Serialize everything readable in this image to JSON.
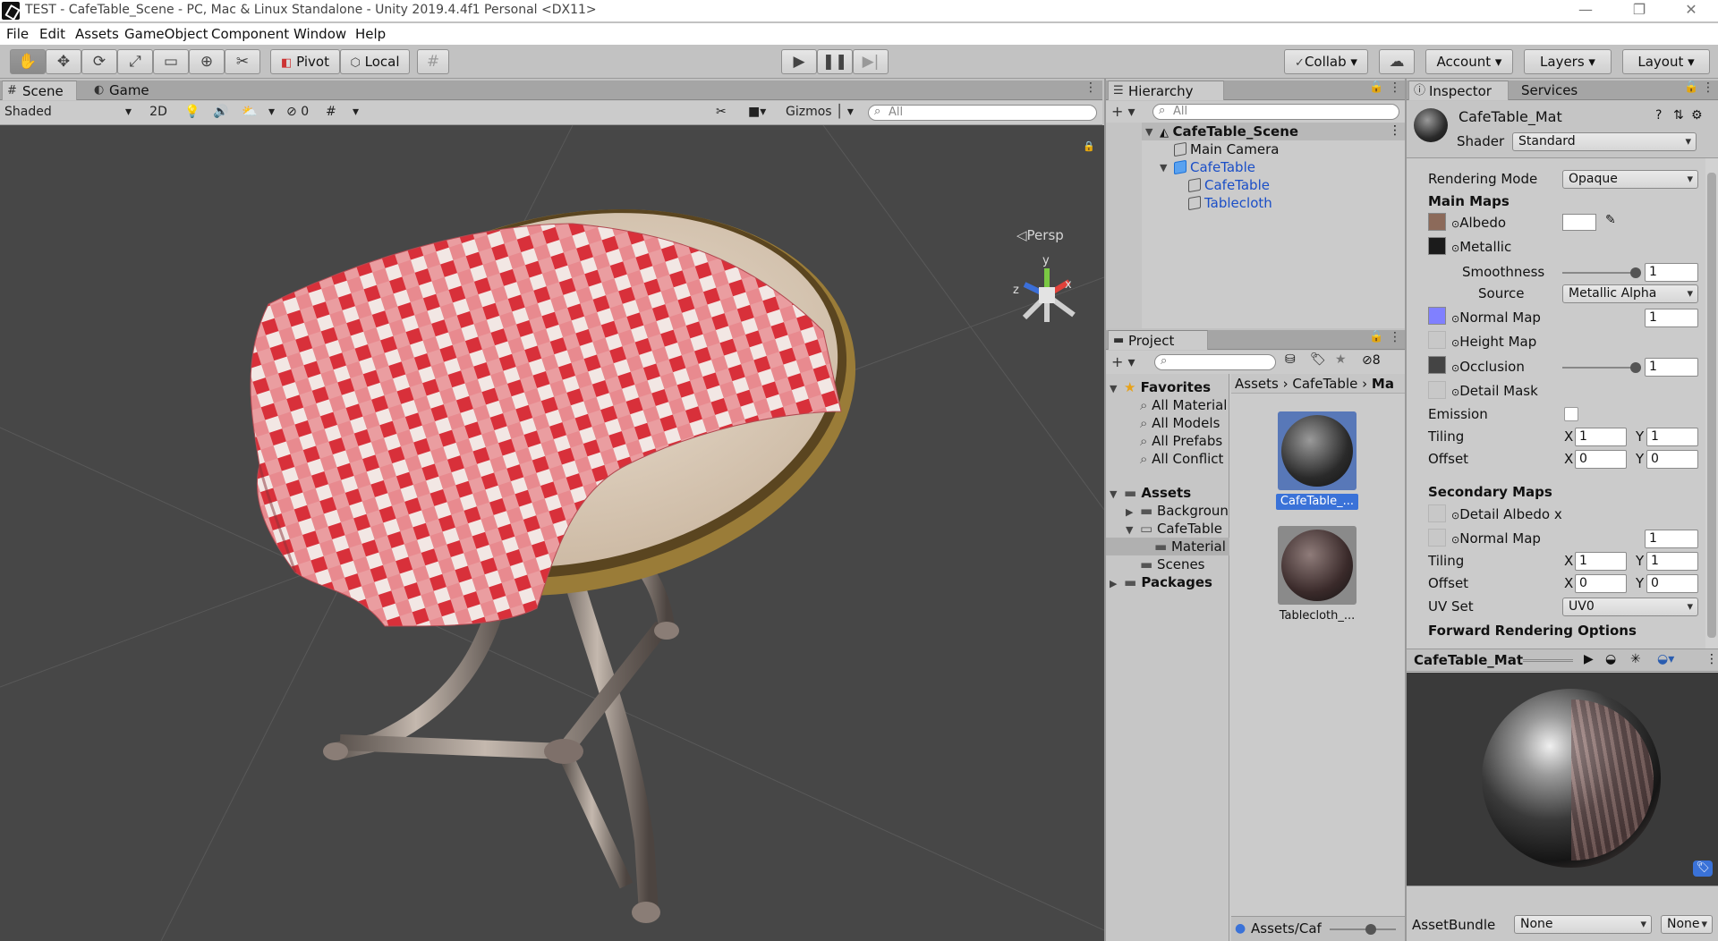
{
  "window": {
    "title": "TEST - CafeTable_Scene - PC, Mac & Linux Standalone - Unity 2019.4.4f1 Personal <DX11>",
    "minimize": "—",
    "maximize": "❐",
    "close": "✕"
  },
  "menu": [
    "File",
    "Edit",
    "Assets",
    "GameObject",
    "Component",
    "Window",
    "Help"
  ],
  "toolbar": {
    "pivot": "Pivot",
    "local": "Local",
    "collab": "Collab",
    "account": "Account",
    "layers": "Layers",
    "layout": "Layout"
  },
  "scene": {
    "tabs": [
      "Scene",
      "Game"
    ],
    "shading": "Shaded",
    "mode_2d": "2D",
    "hidden_count": "0",
    "gizmos": "Gizmos",
    "search_placeholder": "All",
    "persp_label": "Persp",
    "axis_y": "y",
    "axis_x": "x",
    "axis_z": "z"
  },
  "hierarchy": {
    "tab": "Hierarchy",
    "search_placeholder": "All",
    "items": [
      "CafeTable_Scene",
      "Main Camera",
      "CafeTable",
      "CafeTable",
      "Tablecloth"
    ]
  },
  "project": {
    "tab": "Project",
    "hidden_count": "8",
    "favorites_label": "Favorites",
    "favorites": [
      "All Material",
      "All Models",
      "All Prefabs",
      "All Conflict"
    ],
    "assets_label": "Assets",
    "assets": [
      "Backgroun",
      "CafeTable",
      "Material",
      "Scenes"
    ],
    "packages_label": "Packages",
    "breadcrumb": [
      "Assets",
      "CafeTable",
      "Ma"
    ],
    "files": [
      "CafeTable_...",
      "Tablecloth_..."
    ],
    "path_label": "Assets/Caf"
  },
  "inspector": {
    "tabs": [
      "Inspector",
      "Services"
    ],
    "material_name": "CafeTable_Mat",
    "shader_label": "Shader",
    "shader_value": "Standard",
    "rendering_mode_label": "Rendering Mode",
    "rendering_mode_value": "Opaque",
    "main_maps": "Main Maps",
    "albedo": "Albedo",
    "metallic": "Metallic",
    "smoothness": "Smoothness",
    "smoothness_value": "1",
    "source": "Source",
    "source_value": "Metallic Alpha",
    "normal_map": "Normal Map",
    "normal_value": "1",
    "height_map": "Height Map",
    "occlusion": "Occlusion",
    "occlusion_value": "1",
    "detail_mask": "Detail Mask",
    "emission": "Emission",
    "tiling": "Tiling",
    "offset": "Offset",
    "x": "X",
    "y": "Y",
    "tiling_x": "1",
    "tiling_y": "1",
    "offset_x": "0",
    "offset_y": "0",
    "secondary_maps": "Secondary Maps",
    "detail_albedo": "Detail Albedo x",
    "normal_map2": "Normal Map",
    "normal2_value": "1",
    "tiling2_x": "1",
    "tiling2_y": "1",
    "offset2_x": "0",
    "offset2_y": "0",
    "uv_set": "UV Set",
    "uv_set_value": "UV0",
    "forward_options": "Forward Rendering Options",
    "preview_title": "CafeTable_Mat",
    "assetbundle_label": "AssetBundle",
    "assetbundle_value": "None",
    "assetbundle_variant": "None"
  },
  "colors": {
    "editor_bg": "#c2c2c2",
    "scene_bg": "#474747",
    "selection": "#3a72d8",
    "link_blue": "#1a4ec7"
  }
}
